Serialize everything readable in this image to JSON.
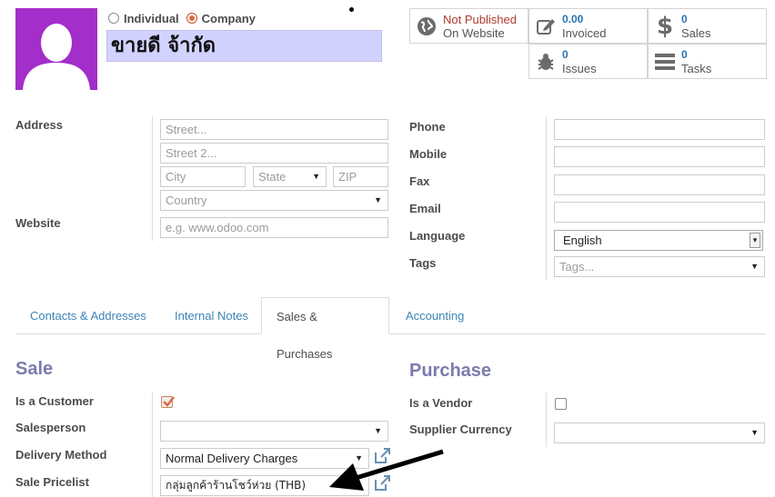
{
  "partner": {
    "type_options": [
      {
        "label": "Individual",
        "checked": false
      },
      {
        "label": "Company",
        "checked": true
      }
    ],
    "name": "ขายดี จ้ากัด"
  },
  "smart_buttons": {
    "website": {
      "status": "Not Published",
      "label": "On Website",
      "status_color": "#b03a2e"
    },
    "invoiced": {
      "value": "0.00",
      "label": "Invoiced"
    },
    "sales": {
      "value": "0",
      "label": "Sales"
    },
    "issues": {
      "value": "0",
      "label": "Issues"
    },
    "tasks": {
      "value": "0",
      "label": "Tasks"
    }
  },
  "address": {
    "label": "Address",
    "street_placeholder": "Street...",
    "street2_placeholder": "Street 2...",
    "city_placeholder": "City",
    "state_placeholder": "State",
    "zip_placeholder": "ZIP",
    "country_placeholder": "Country"
  },
  "website": {
    "label": "Website",
    "placeholder": "e.g. www.odoo.com"
  },
  "contact": {
    "phone_label": "Phone",
    "mobile_label": "Mobile",
    "fax_label": "Fax",
    "email_label": "Email",
    "language_label": "Language",
    "language_value": "English",
    "tags_label": "Tags",
    "tags_placeholder": "Tags..."
  },
  "tabs": [
    {
      "label": "Contacts & Addresses",
      "active": false
    },
    {
      "label": "Internal Notes",
      "active": false
    },
    {
      "label": "Sales & Purchases",
      "active": true
    },
    {
      "label": "Accounting",
      "active": false
    }
  ],
  "sale": {
    "title": "Sale",
    "is_customer_label": "Is a Customer",
    "is_customer": true,
    "salesperson_label": "Salesperson",
    "salesperson_value": "",
    "delivery_method_label": "Delivery Method",
    "delivery_method_value": "Normal Delivery Charges",
    "pricelist_label": "Sale Pricelist",
    "pricelist_value": "กลุ่มลูกค้าร้านโชว์ห่วย (THB)"
  },
  "purchase": {
    "title": "Purchase",
    "is_vendor_label": "Is a Vendor",
    "is_vendor": false,
    "supplier_currency_label": "Supplier Currency",
    "supplier_currency_value": ""
  },
  "colors": {
    "avatar_bg": "#a32ec9",
    "name_field_bg": "#d2d2ff",
    "link_blue": "#3d83b5",
    "section_title": "#7c7bad",
    "radio_accent": "#e0693f"
  }
}
